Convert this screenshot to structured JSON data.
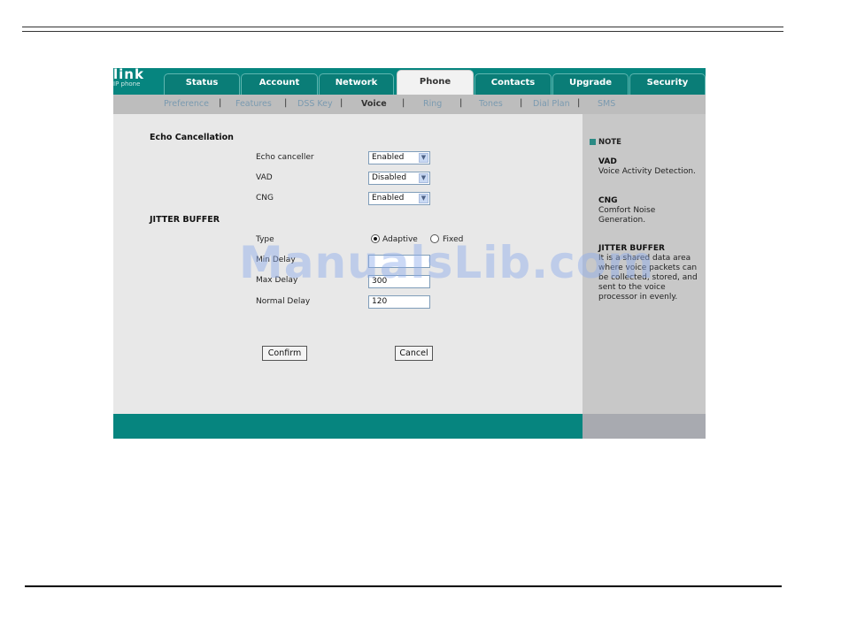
{
  "logo": {
    "text": "link",
    "sub": "IP phone"
  },
  "tabs": [
    {
      "label": "Status",
      "active": false
    },
    {
      "label": "Account",
      "active": false
    },
    {
      "label": "Network",
      "active": false
    },
    {
      "label": "Phone",
      "active": true
    },
    {
      "label": "Contacts",
      "active": false
    },
    {
      "label": "Upgrade",
      "active": false
    },
    {
      "label": "Security",
      "active": false
    }
  ],
  "subnav": [
    {
      "label": "Preference",
      "active": false
    },
    {
      "label": "Features",
      "active": false
    },
    {
      "label": "DSS Key",
      "active": false
    },
    {
      "label": "Voice",
      "active": true
    },
    {
      "label": "Ring",
      "active": false
    },
    {
      "label": "Tones",
      "active": false
    },
    {
      "label": "Dial Plan",
      "active": false
    },
    {
      "label": "SMS",
      "active": false
    }
  ],
  "subnav_separator": "|",
  "echo": {
    "title": "Echo Cancellation",
    "rows": [
      {
        "label": "Echo canceller",
        "value": "Enabled"
      },
      {
        "label": "VAD",
        "value": "Disabled"
      },
      {
        "label": "CNG",
        "value": "Enabled"
      }
    ]
  },
  "jitter": {
    "title": "JITTER BUFFER",
    "type_label": "Type",
    "type_options": [
      {
        "label": "Adaptive",
        "selected": true
      },
      {
        "label": "Fixed",
        "selected": false
      }
    ],
    "min_delay_label": "Min Delay",
    "min_delay_value": "",
    "max_delay_label": "Max Delay",
    "max_delay_value": "300",
    "normal_delay_label": "Normal Delay",
    "normal_delay_value": "120"
  },
  "buttons": {
    "confirm": "Confirm",
    "cancel": "Cancel"
  },
  "note": {
    "heading": "NOTE",
    "items": [
      {
        "title": "VAD",
        "body": "Voice Activity Detection."
      },
      {
        "title": "CNG",
        "body": "Comfort Noise Generation."
      },
      {
        "title": "JITTER BUFFER",
        "body": "It is a shared data area where voice packets can be collected, stored, and sent to the voice processor in evenly."
      }
    ]
  },
  "watermark": "ManualsLib.com",
  "colors": {
    "teal": "#06857f",
    "subnav_gray": "#bdbdbd",
    "note_gray": "#c8c8c8"
  }
}
